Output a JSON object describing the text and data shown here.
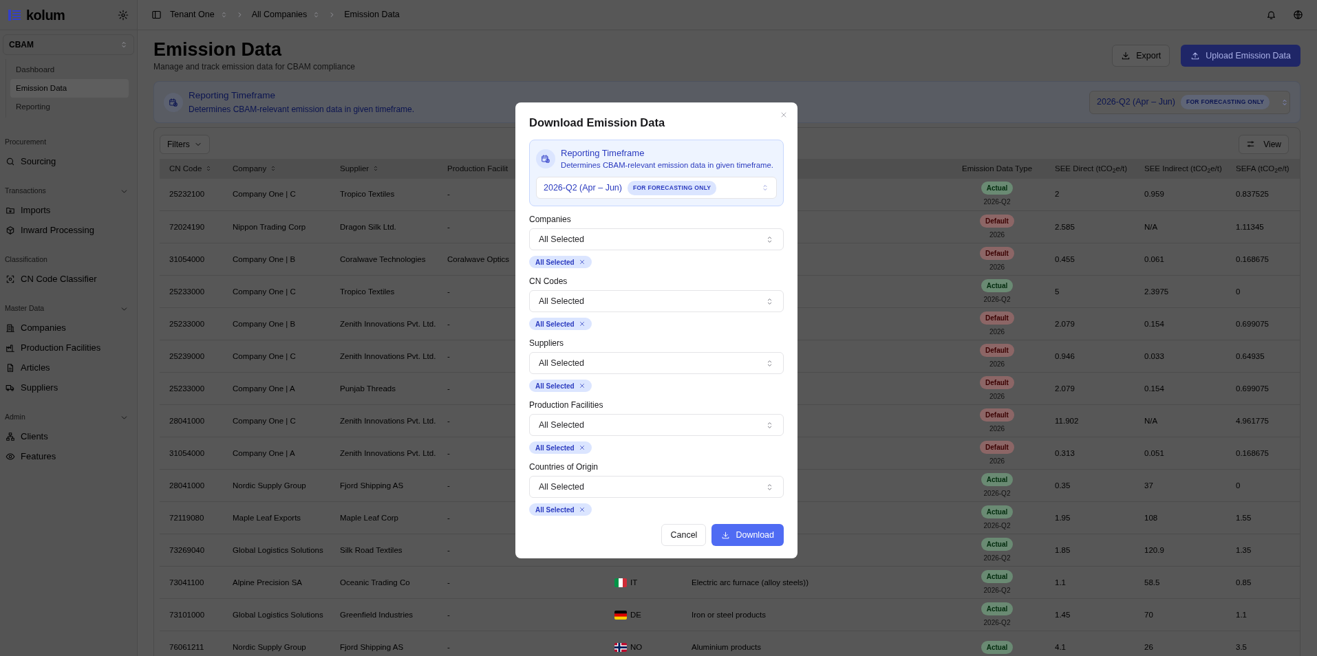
{
  "sidebar": {
    "logo": "kolum",
    "module": "CBAM",
    "module_items": [
      {
        "label": "Dashboard",
        "selected": false
      },
      {
        "label": "Emission Data",
        "selected": true
      },
      {
        "label": "Reporting",
        "selected": false
      }
    ],
    "groups": [
      {
        "title": "Procurement",
        "toggle": false,
        "items": [
          "Sourcing"
        ]
      },
      {
        "title": "Transactions",
        "toggle": true,
        "items": [
          "Imports",
          "Inward Processing"
        ]
      },
      {
        "title": "Classification",
        "toggle": false,
        "items": [
          "CN Code Classifier"
        ]
      },
      {
        "title": "Master Data",
        "toggle": true,
        "items": [
          "Companies",
          "Production Facilities",
          "Articles",
          "Suppliers"
        ]
      },
      {
        "title": "Admin",
        "toggle": true,
        "items": [
          "Clients",
          "Features"
        ]
      }
    ]
  },
  "breadcrumb": [
    {
      "label": "Tenant One",
      "switcher": true
    },
    {
      "label": "All Companies",
      "switcher": true
    },
    {
      "label": "Emission Data",
      "switcher": false
    }
  ],
  "page": {
    "title": "Emission Data",
    "subtitle": "Manage and track emission data for CBAM compliance",
    "buttons": [
      {
        "label": "Export",
        "kind": "outline"
      },
      {
        "label": "Upload Emission Data",
        "kind": "primary"
      }
    ]
  },
  "timeframe": {
    "title": "Reporting Timeframe",
    "description": "Determines CBAM-relevant emission data in given timeframe.",
    "value": "2026-Q2 (Apr – Jun)",
    "badge": "FOR FORECASTING ONLY"
  },
  "toolbar": {
    "filters": "Filters",
    "view": "View"
  },
  "table": {
    "columns_left": [
      {
        "label": "CN Code",
        "sortable": true
      },
      {
        "label": "Company",
        "sortable": true
      },
      {
        "label": "Supplier",
        "sortable": true
      },
      {
        "label": "Production Facilit"
      }
    ],
    "columns_right": [
      {
        "label": "Emission Data Type"
      },
      {
        "label": "SEE Direct (tCO$_{2}$e/t)"
      },
      {
        "label": "SEE Indirect (tCO$_{2}$e/t)"
      },
      {
        "label": "SEFA (tCO$_{2}$e/t)"
      }
    ],
    "rows": [
      {
        "cn_code": "25232100",
        "company": "Company One | C",
        "supplier": "Tropico Textiles",
        "facility": "-",
        "data_type": {
          "kind": "actual",
          "label": "Actual",
          "period": "2026-Q2"
        },
        "see_direct": "2",
        "see_indirect": "0.959",
        "sefa": "0.837525"
      },
      {
        "cn_code": "72024190",
        "company": "Nippon Trading Corp",
        "supplier": "Dragon Silk Ltd.",
        "facility": "-",
        "data_type": {
          "kind": "default",
          "label": "Default",
          "period": "2026"
        },
        "see_direct": "2.585",
        "see_indirect": "N/A",
        "sefa": "1.11345"
      },
      {
        "cn_code": "31054000",
        "company": "Company One | B",
        "supplier": "Coralwave Technologies",
        "facility": "Coralwave Optics",
        "data_type": {
          "kind": "default",
          "label": "Default",
          "period": "2026"
        },
        "see_direct": "0.455",
        "see_indirect": "0.061",
        "sefa": "0.168675"
      },
      {
        "cn_code": "25233000",
        "company": "Company One | C",
        "supplier": "Tropico Textiles",
        "facility": "-",
        "data_type": {
          "kind": "actual",
          "label": "Actual",
          "period": "2026-Q2"
        },
        "see_direct": "5",
        "see_indirect": "2.3975",
        "sefa": "0"
      },
      {
        "cn_code": "25233000",
        "company": "Company One | B",
        "supplier": "Zenith Innovations Pvt. Ltd.",
        "facility": "-",
        "data_type": {
          "kind": "default",
          "label": "Default",
          "period": "2026"
        },
        "see_direct": "2.079",
        "see_indirect": "0.154",
        "sefa": "0.699075"
      },
      {
        "cn_code": "25239000",
        "company": "Company One | C",
        "supplier": "Zenith Innovations Pvt. Ltd.",
        "facility": "-",
        "data_type": {
          "kind": "default",
          "label": "Default",
          "period": "2026"
        },
        "see_direct": "0.946",
        "see_indirect": "0.033",
        "sefa": "0.64935"
      },
      {
        "cn_code": "25233000",
        "company": "Company One | A",
        "supplier": "Punjab Threads",
        "facility": "-",
        "data_type": {
          "kind": "default",
          "label": "Default",
          "period": "2026"
        },
        "see_direct": "2.079",
        "see_indirect": "0.154",
        "sefa": "0.699075"
      },
      {
        "cn_code": "28041000",
        "company": "Company One | C",
        "supplier": "Zenith Innovations Pvt. Ltd.",
        "facility": "-",
        "data_type": {
          "kind": "default",
          "label": "Default",
          "period": "2026"
        },
        "see_direct": "11.902",
        "see_indirect": "N/A",
        "sefa": "4.961775"
      },
      {
        "cn_code": "31054000",
        "company": "Company One | A",
        "supplier": "Zenith Innovations Pvt. Ltd.",
        "facility": "-",
        "data_type": {
          "kind": "default",
          "label": "Default",
          "period": "2026"
        },
        "see_direct": "0.313",
        "see_indirect": "0.051",
        "sefa": "0.168675"
      },
      {
        "cn_code": "28041000",
        "company": "Nordic Supply Group",
        "supplier": "Fjord Shipping AS",
        "facility": "-",
        "data_type": {
          "kind": "actual",
          "label": "Actual",
          "period": "2026-Q2"
        },
        "see_direct": "0.35",
        "see_indirect": "37",
        "sefa": "0"
      },
      {
        "cn_code": "72119080",
        "company": "Maple Leaf Exports",
        "supplier": "Maple Leaf Corp",
        "facility": "-",
        "data_type": {
          "kind": "actual",
          "label": "Actual",
          "period": "2026-Q2"
        },
        "see_direct": "1.95",
        "see_indirect": "108",
        "sefa": "1.55"
      },
      {
        "cn_code": "73269040",
        "company": "Global Logistics Solutions",
        "supplier": "Silk Road Textiles",
        "facility": "-",
        "data_type": {
          "kind": "actual",
          "label": "Actual",
          "period": "2026-Q2"
        },
        "see_direct": "1.85",
        "see_indirect": "120.9",
        "sefa": "1.35"
      },
      {
        "cn_code": "73041100",
        "company": "Alpine Precision SA",
        "supplier": "Oceanic Trading Co",
        "facility": "-",
        "country": {
          "code": "IT",
          "flag": {
            "kind": "vertical",
            "stripes": [
              {
                "color": "#009246"
              },
              {
                "color": "#ffffff"
              },
              {
                "color": "#ce2b37"
              }
            ]
          }
        },
        "method": "Electric arc furnace (alloy steels))",
        "data_type": {
          "kind": "actual",
          "label": "Actual",
          "period": "2026-Q2"
        },
        "see_direct": "1.1",
        "see_indirect": "58.5",
        "sefa": "0.85"
      },
      {
        "cn_code": "73101000",
        "company": "Global Logistics Solutions",
        "supplier": "Greenfield Industries",
        "facility": "-",
        "country": {
          "code": "DE",
          "flag": {
            "kind": "horizontal",
            "stripes": [
              {
                "color": "#000000"
              },
              {
                "color": "#dd0000"
              },
              {
                "color": "#ffce00"
              }
            ]
          }
        },
        "method": "Iron or steel products",
        "data_type": {
          "kind": "actual",
          "label": "Actual",
          "period": "2026-Q2"
        },
        "see_direct": "1.45",
        "see_indirect": "70",
        "sefa": "1.1"
      },
      {
        "cn_code": "76061211",
        "company": "Nordic Supply Group",
        "supplier": "Fjord Shipping AS",
        "facility": "-",
        "country": {
          "code": "NO",
          "flag": {
            "kind": "cross",
            "stripes": [
              {
                "color": "#ba0c2f"
              },
              {
                "color": "#ffffff"
              },
              {
                "color": "#00205b"
              }
            ]
          }
        },
        "method": "Aluminium products",
        "data_type": {
          "kind": "actual",
          "label": "Actual"
        },
        "see_direct": "4.1",
        "see_indirect": "26",
        "sefa": "3.5"
      }
    ]
  },
  "modal": {
    "title": "Download Emission Data",
    "timeframe": {
      "title": "Reporting Timeframe",
      "description": "Determines CBAM-relevant emission data in given timeframe.",
      "value": "2026-Q2 (Apr – Jun)",
      "badge": "FOR FORECASTING ONLY"
    },
    "fields": [
      {
        "label": "Companies",
        "value": "All Selected",
        "chips": [
          "All Selected"
        ]
      },
      {
        "label": "CN Codes",
        "value": "All Selected",
        "chips": [
          "All Selected"
        ]
      },
      {
        "label": "Suppliers",
        "value": "All Selected",
        "chips": [
          "All Selected"
        ]
      },
      {
        "label": "Production Facilities",
        "value": "All Selected",
        "chips": [
          "All Selected"
        ]
      },
      {
        "label": "Countries of Origin",
        "value": "All Selected",
        "chips": [
          "All Selected"
        ]
      }
    ],
    "buttons": [
      {
        "label": "Cancel",
        "kind": "outline"
      },
      {
        "label": "Download",
        "kind": "primary"
      }
    ]
  }
}
